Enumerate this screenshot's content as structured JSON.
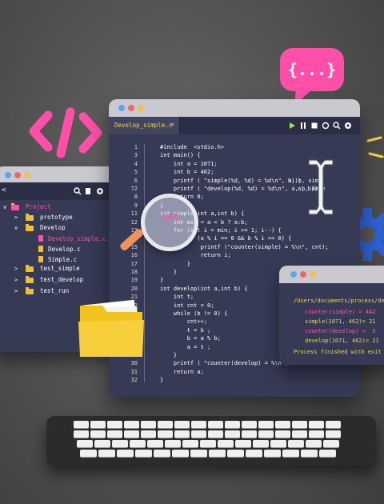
{
  "colors": {
    "pink": "#ff4fa8",
    "yellow": "#f4d24a",
    "panel": "#363a55"
  },
  "editor": {
    "tab_label": "Develop_simple.c",
    "tab_close": "×",
    "toolbar_icons": [
      "play-icon",
      "pause-icon",
      "stop-icon",
      "refresh-icon",
      "search-icon",
      "gear-icon"
    ],
    "lines": [
      {
        "n": "1",
        "text": "#include  <stdio.h>"
      },
      {
        "n": "3",
        "text": "int main() {"
      },
      {
        "n": "4",
        "text": "    int a = 1071;"
      },
      {
        "n": "5",
        "text": "    int b = 462;"
      },
      {
        "n": "6",
        "text": "    printf ( \"simple(%d, %d) = %d\\n\", a, b, simp"
      },
      {
        "n": "72",
        "text": "    printf ( \"develop(%d, %d) = %d\\n\", a, b, deve"
      },
      {
        "n": "8",
        "text": "    return 0;"
      },
      {
        "n": "9",
        "text": "}"
      },
      {
        "n": "11",
        "text": "int simple(int a,int b) {"
      },
      {
        "n": "12",
        "text": "    int min = a < b ? a:b;"
      },
      {
        "n": "13",
        "text": "    for (int i = min; i >= 1; i--) {"
      },
      {
        "n": "14",
        "text": "        if (a % i == 0 && b % i == 0) {"
      },
      {
        "n": "15",
        "text": "            printf (\"counter(simple) = %\\n\", cnt);"
      },
      {
        "n": "16",
        "text": "            return i;"
      },
      {
        "n": "17",
        "text": "        }"
      },
      {
        "n": "18",
        "text": "    }"
      },
      {
        "n": "19",
        "text": "}"
      },
      {
        "n": "20",
        "text": "int develop(int a,int b) {"
      },
      {
        "n": "21",
        "text": "    int t;"
      },
      {
        "n": "22",
        "text": "    int cnt = 0;"
      },
      {
        "n": "23",
        "text": "    while (b != 0) {"
      },
      {
        "n": "24",
        "text": "        cnt++;"
      },
      {
        "n": "25",
        "text": "        t = b ;"
      },
      {
        "n": "26",
        "text": "        b = a % b;"
      },
      {
        "n": "27",
        "text": "        a = t ;"
      },
      {
        "n": "28",
        "text": "    }"
      },
      {
        "n": "30",
        "text": "    printf ( \"counter(develop) = %\\n\", cn"
      },
      {
        "n": "31",
        "text": "    return a;"
      },
      {
        "n": "32",
        "text": "}"
      }
    ],
    "lines_tail": [
      "b));",
      "a, b));"
    ]
  },
  "magnifier": {
    "text": "int"
  },
  "explorer": {
    "back": "<",
    "items": [
      {
        "label": "Project",
        "depth": 0,
        "type": "folder-pink",
        "chev": "v"
      },
      {
        "label": "prototype",
        "depth": 1,
        "type": "folder",
        "chev": ">"
      },
      {
        "label": "Develop",
        "depth": 1,
        "type": "folder",
        "chev": "v"
      },
      {
        "label": "Develop_simple.c",
        "depth": 2,
        "type": "file-pink"
      },
      {
        "label": "Develop.c",
        "depth": 2,
        "type": "file"
      },
      {
        "label": "Simple.c",
        "depth": 2,
        "type": "file"
      },
      {
        "label": "test_simple",
        "depth": 1,
        "type": "folder",
        "chev": ">"
      },
      {
        "label": "test_develop",
        "depth": 1,
        "type": "folder",
        "chev": ">"
      },
      {
        "label": "test_run",
        "depth": 1,
        "type": "folder",
        "chev": ">"
      }
    ]
  },
  "terminal": {
    "path": "/Users/documents/process/develo",
    "out": [
      "counter(simple) = 442",
      "simple(1071, 462)= 21",
      "counter(develop) =  3",
      "develop(1071, 462)= 21"
    ],
    "finished": "Process finished with exit co"
  },
  "bubble": {
    "text": "{...}"
  }
}
